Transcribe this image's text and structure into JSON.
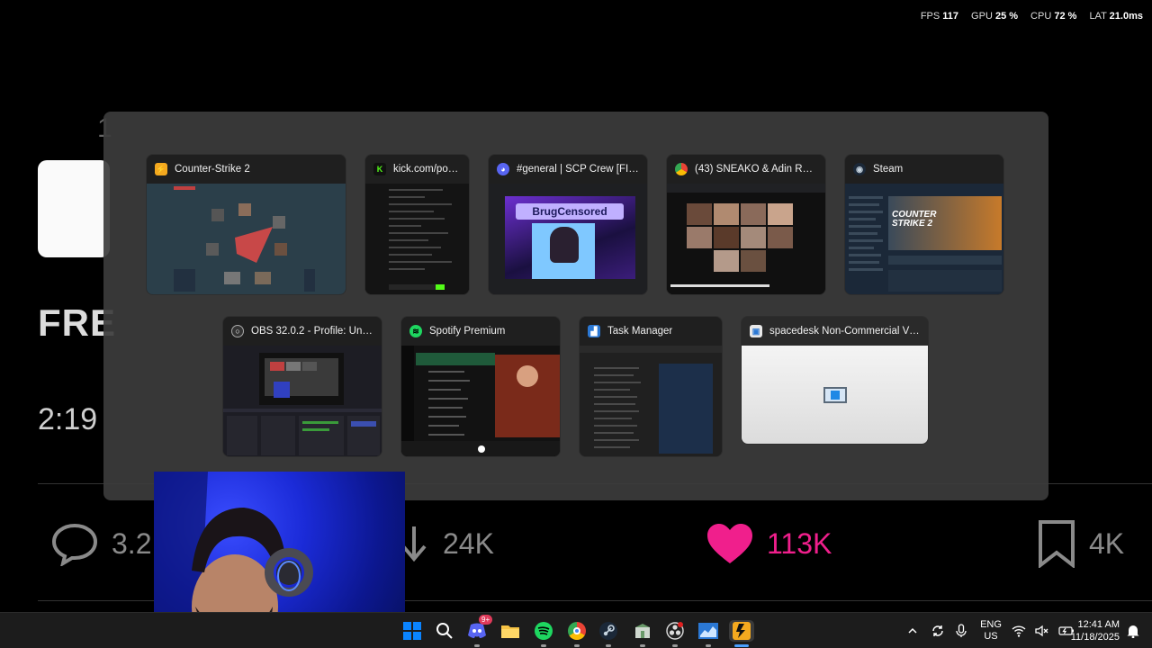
{
  "perf_overlay": {
    "fps_label": "FPS",
    "fps_value": "117",
    "gpu_label": "GPU",
    "gpu_value": "25",
    "cpu_label": "CPU",
    "cpu_value": "72",
    "pct": "%",
    "lat_label": "LAT",
    "lat_value": "21.0",
    "lat_unit": "ms"
  },
  "background_post": {
    "title_fragment": "FRE",
    "time_fragment": "2:19",
    "number_fragment": "1",
    "replies": "3.2",
    "reposts": "24K",
    "likes": "113K",
    "bookmarks": "4K"
  },
  "switcher": {
    "windows": [
      {
        "title": "Counter-Strike 2",
        "icon": "cs2-icon"
      },
      {
        "title": "kick.com/popo...",
        "icon": "kick-icon"
      },
      {
        "title": "#general | SCP Crew [FINAL...",
        "icon": "discord-icon"
      },
      {
        "title": "(43) SNEAKO & Adin Ross H...",
        "icon": "chrome-icon"
      },
      {
        "title": "Steam",
        "icon": "steam-icon"
      },
      {
        "title": "OBS 32.0.2 - Profile: Untitled...",
        "icon": "obs-icon"
      },
      {
        "title": "Spotify Premium",
        "icon": "spotify-icon"
      },
      {
        "title": "Task Manager",
        "icon": "task-manager-icon"
      },
      {
        "title": "spacedesk Non-Commercial Viewer...",
        "icon": "spacedesk-icon"
      }
    ],
    "discord_overlay_text": "BrugCensored",
    "steam_banner_text": "COUNTER STRIKE 2"
  },
  "taskbar": {
    "discord_badge": "9+",
    "lang_line1": "ENG",
    "lang_line2": "US",
    "time": "12:41 AM",
    "date": "11/18/2025"
  },
  "colors": {
    "likes_pink": "#f01f8c",
    "switcher_bg": "#3c3c3c",
    "taskbar_bg": "#1c1c1c",
    "windows_blue": "#0a84ff"
  }
}
